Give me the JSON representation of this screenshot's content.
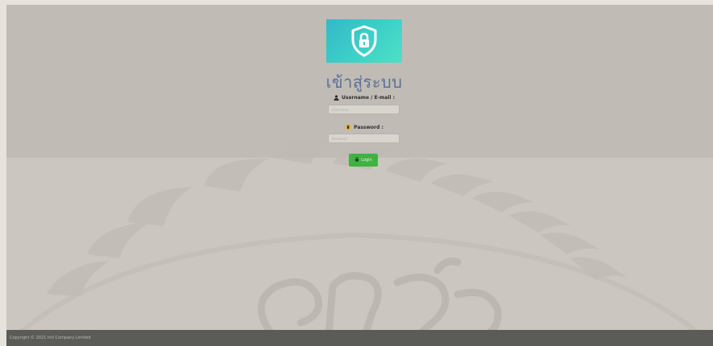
{
  "login": {
    "title": "เข้าสู่ระบบ",
    "username_label": "Username / E-mail :",
    "username_placeholder": "Username",
    "password_label": "Password :",
    "password_placeholder": "Password",
    "login_button": "Login"
  },
  "icons": {
    "logo": "shield-lock-icon",
    "username": "user-icon",
    "password": "key-icon",
    "login": "login-icon"
  },
  "footer": {
    "copyright": "Copyright © 2021 Intl Company Limited"
  },
  "colors": {
    "logo_gradient_start": "#34b8c9",
    "logo_gradient_end": "#4fe0c4",
    "title": "#5b6e98",
    "login_button": "#3fb241",
    "footer_bar": "#5b5b58"
  }
}
